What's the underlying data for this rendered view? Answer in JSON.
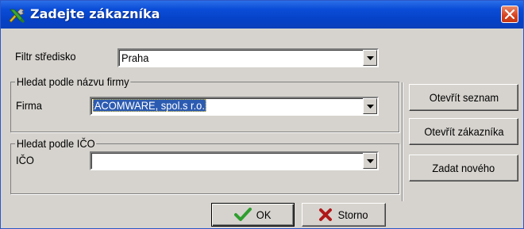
{
  "window": {
    "title": "Zadejte zákazníka",
    "app_icon": "tools-icon",
    "close_icon": "close-icon"
  },
  "filter": {
    "label": "Filtr středisko",
    "value": "Praha"
  },
  "group_firma": {
    "legend": "Hledat podle názvu firmy",
    "label": "Firma",
    "value": "ACOMWARE, spol.s r.o."
  },
  "group_ico": {
    "legend": "Hledat podle IČO",
    "label": "IČO",
    "value": ""
  },
  "side_buttons": {
    "open_list": "Otevřít seznam",
    "open_customer": "Otevřít zákazníka",
    "add_new": "Zadat nového"
  },
  "footer": {
    "ok": "OK",
    "cancel": "Storno"
  },
  "colors": {
    "title_bar": "#0541c7",
    "face": "#d6d3ce",
    "selection": "#2b5ab1",
    "ok_check": "#2f9e2f",
    "cancel_x": "#b01818",
    "close_btn": "#d4411f"
  }
}
